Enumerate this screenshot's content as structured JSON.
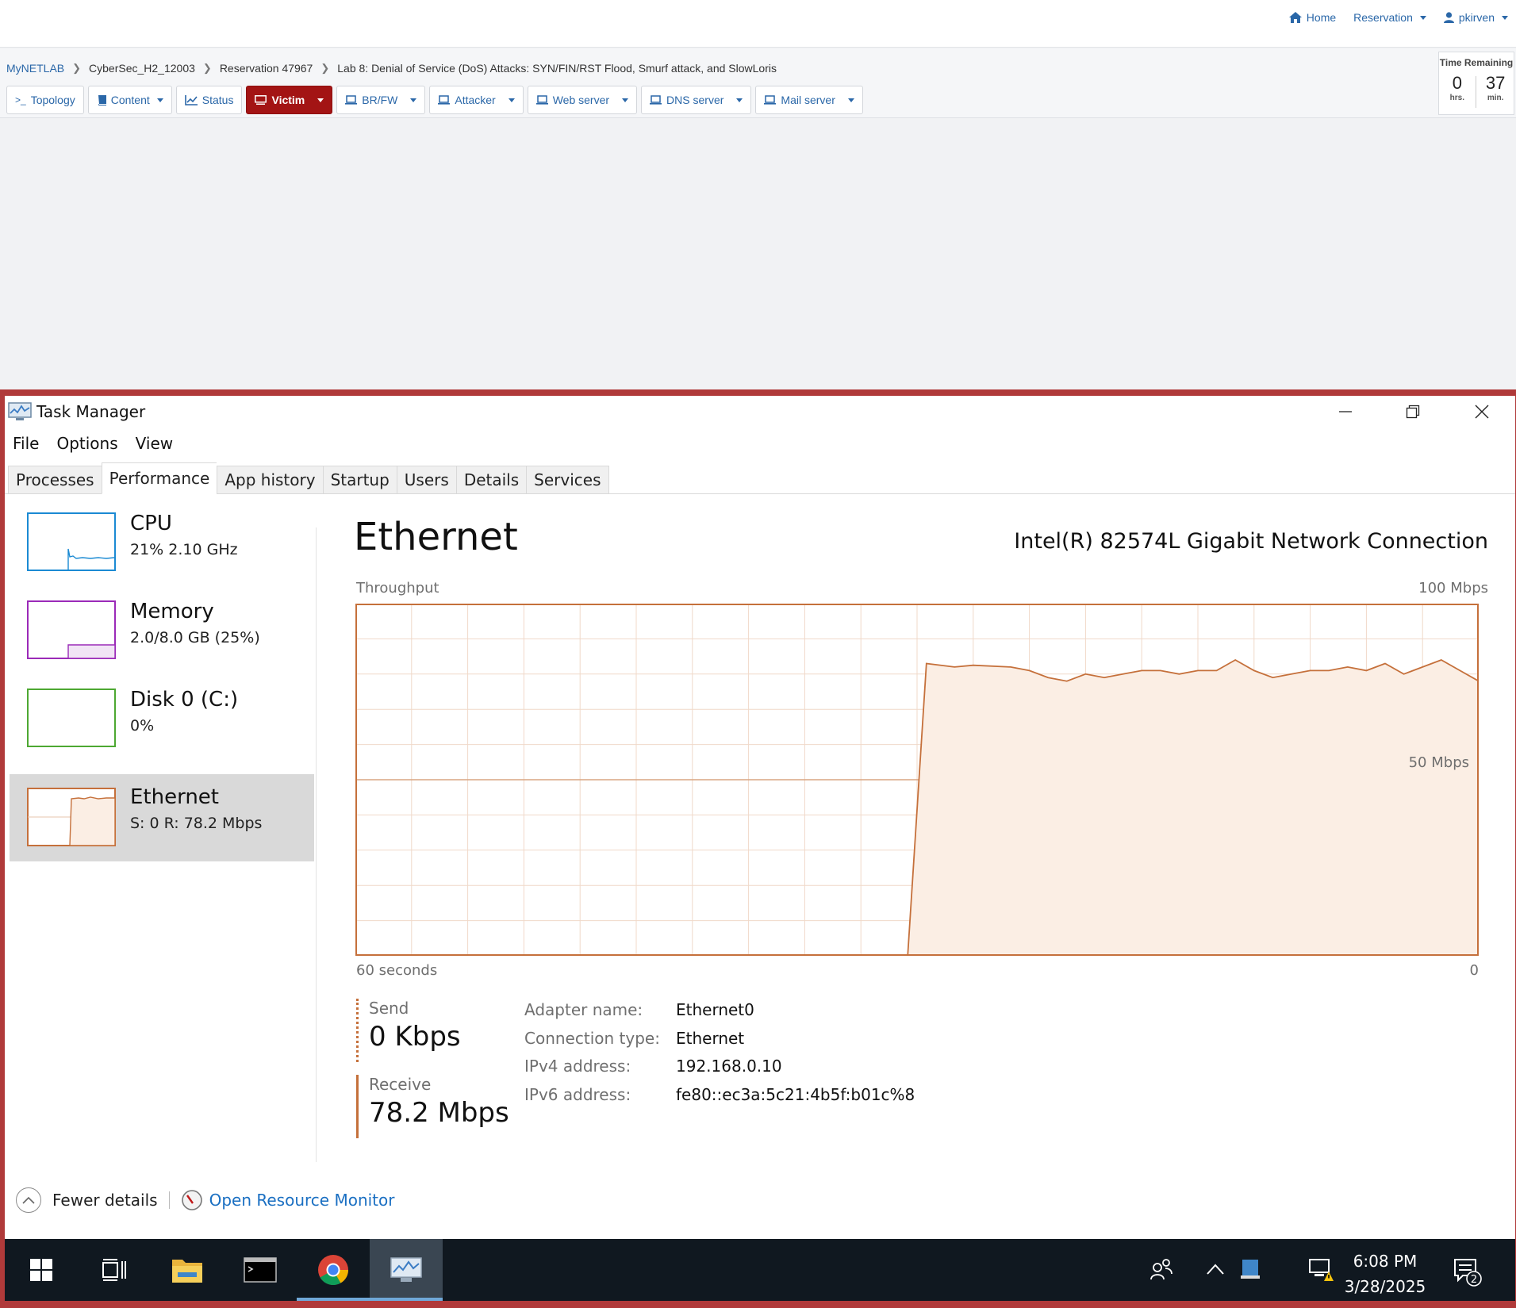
{
  "topnav": {
    "home": "Home",
    "reservation": "Reservation",
    "user": "pkirven"
  },
  "breadcrumb": {
    "items": [
      "MyNETLAB",
      "CyberSec_H2_12003",
      "Reservation 47967",
      "Lab 8: Denial of Service (DoS) Attacks: SYN/FIN/RST Flood, Smurf attack, and SlowLoris"
    ]
  },
  "toolbar": {
    "buttons": [
      {
        "label": "Topology",
        "icon": "terminal-icon"
      },
      {
        "label": "Content",
        "icon": "book-icon"
      },
      {
        "label": "Status",
        "icon": "chart-icon"
      },
      {
        "label": "Victim",
        "icon": "monitor-icon"
      },
      {
        "label": "BR/FW",
        "icon": "laptop-icon"
      },
      {
        "label": "Attacker",
        "icon": "laptop-icon"
      },
      {
        "label": "Web server",
        "icon": "laptop-icon"
      },
      {
        "label": "DNS server",
        "icon": "laptop-icon"
      },
      {
        "label": "Mail server",
        "icon": "laptop-icon"
      }
    ]
  },
  "timer": {
    "title": "Time Remaining",
    "hours": "0",
    "hours_unit": "hrs.",
    "minutes": "37",
    "minutes_unit": "min."
  },
  "taskmgr": {
    "title": "Task Manager",
    "menu": [
      "File",
      "Options",
      "View"
    ],
    "tabs": [
      "Processes",
      "Performance",
      "App history",
      "Startup",
      "Users",
      "Details",
      "Services"
    ],
    "active_tab": "Performance",
    "resources": [
      {
        "name": "CPU",
        "sub": "21%  2.10 GHz",
        "color": "#1b8ad3"
      },
      {
        "name": "Memory",
        "sub": "2.0/8.0 GB (25%)",
        "color": "#9b2ab8"
      },
      {
        "name": "Disk 0 (C:)",
        "sub": "0%",
        "color": "#4da832"
      },
      {
        "name": "Ethernet",
        "sub": "S: 0  R: 78.2 Mbps",
        "color": "#c5703b"
      }
    ],
    "detail": {
      "title": "Ethernet",
      "adapter": "Intel(R) 82574L Gigabit Network Connection",
      "throughput_label": "Throughput",
      "max_label": "100 Mbps",
      "mid_label": "50 Mbps",
      "time_label": "60 seconds",
      "zero_label": "0",
      "send_label": "Send",
      "send_value": "0 Kbps",
      "receive_label": "Receive",
      "receive_value": "78.2 Mbps",
      "properties": [
        {
          "key": "Adapter name:",
          "value": "Ethernet0"
        },
        {
          "key": "Connection type:",
          "value": "Ethernet"
        },
        {
          "key": "IPv4 address:",
          "value": "192.168.0.10"
        },
        {
          "key": "IPv6 address:",
          "value": "fe80::ec3a:5c21:4b5f:b01c%8"
        }
      ]
    },
    "footer": {
      "fewer": "Fewer details",
      "resmon": "Open Resource Monitor"
    }
  },
  "chart_data": {
    "type": "area",
    "title": "Throughput",
    "xlabel": "60 seconds",
    "ylabel": "",
    "ylim": [
      0,
      100
    ],
    "xlim": [
      60,
      0
    ],
    "unit": "Mbps",
    "grid": true,
    "color": "#c5703b",
    "series": [
      {
        "x": [
          60,
          57,
          54,
          51,
          48,
          45,
          42,
          39,
          36,
          33,
          30.5,
          29.5,
          28,
          27,
          25,
          24,
          23,
          22,
          21,
          20,
          19,
          18,
          17,
          16,
          15,
          14,
          13,
          12,
          11,
          10,
          9,
          8,
          7,
          6,
          5,
          4,
          3,
          2,
          1,
          0
        ],
        "values": [
          0,
          0,
          0,
          0,
          0,
          0,
          0,
          0,
          0,
          0,
          0,
          83,
          82,
          82.5,
          82,
          81,
          79,
          78,
          80,
          79,
          80,
          81,
          81,
          80,
          81,
          81,
          84,
          81,
          79,
          80,
          81,
          81,
          82,
          81,
          83,
          80,
          82,
          84,
          81,
          78
        ]
      }
    ]
  },
  "taskbar": {
    "clock_time": "6:08 PM",
    "clock_date": "3/28/2025",
    "notification_count": "2"
  }
}
